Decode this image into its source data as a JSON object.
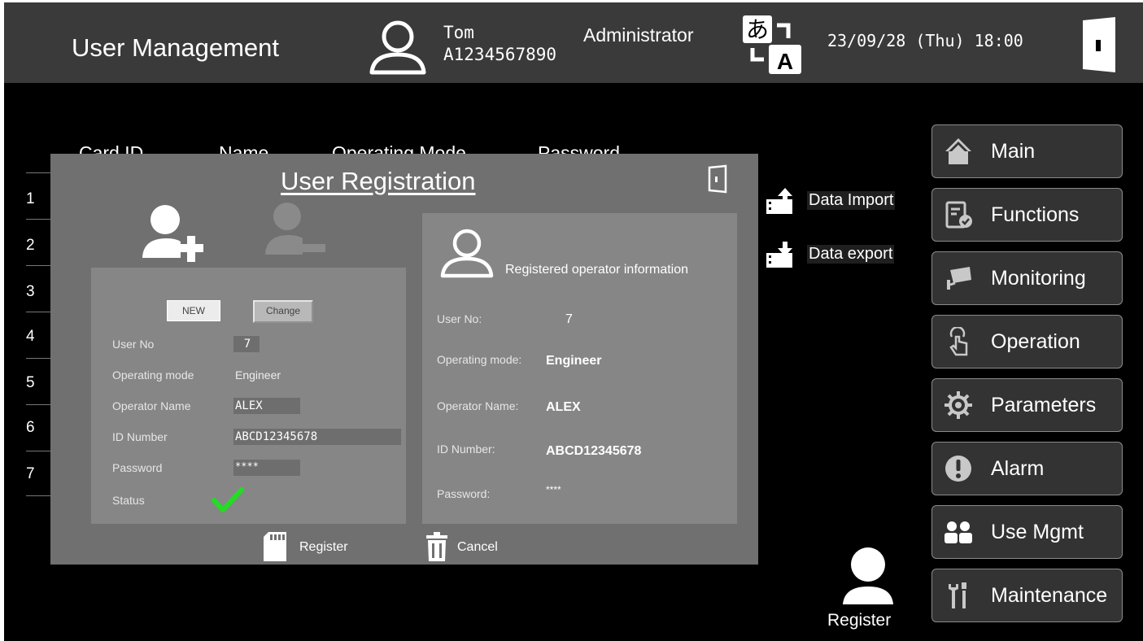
{
  "header": {
    "title": "User Management",
    "user_name": "Tom",
    "user_id": "A1234567890",
    "user_role": "Administrator",
    "datetime": "23/09/28 (Thu) 18:00",
    "lang_glyph_top": "あ",
    "lang_glyph_bottom": "A"
  },
  "table": {
    "columns": [
      "Card ID",
      "Name",
      "Operating Mode",
      "Password"
    ],
    "rows": [
      "1",
      "2",
      "3",
      "4",
      "5",
      "6",
      "7"
    ]
  },
  "data_actions": {
    "import_label": "Data Import",
    "export_label": "Data export"
  },
  "menu": [
    {
      "label": "Main",
      "icon": "home-icon"
    },
    {
      "label": "Functions",
      "icon": "checklist-icon"
    },
    {
      "label": "Monitoring",
      "icon": "cctv-icon"
    },
    {
      "label": "Operation",
      "icon": "touch-icon"
    },
    {
      "label": "Parameters",
      "icon": "gear-icon"
    },
    {
      "label": "Alarm",
      "icon": "alert-icon"
    },
    {
      "label": "Use Mgmt",
      "icon": "users-icon"
    },
    {
      "label": "Maintenance",
      "icon": "tools-icon"
    }
  ],
  "register_button": {
    "label": "Register"
  },
  "modal": {
    "title": "User Registration",
    "new_label": "NEW",
    "change_label": "Change",
    "form": {
      "user_no_label": "User No",
      "user_no": "7",
      "mode_label": "Operating mode",
      "mode": "Engineer",
      "name_label": "Operator Name",
      "name": "ALEX",
      "id_label": "ID Number",
      "id": "ABCD12345678",
      "password_label": "Password",
      "password": "****",
      "status_label": "Status"
    },
    "info": {
      "title": "Registered operator information",
      "user_no_label": "User No:",
      "user_no": "7",
      "mode_label": "Operating mode:",
      "mode": "Engineer",
      "name_label": "Operator Name:",
      "name": "ALEX",
      "id_label": "ID Number:",
      "id": "ABCD12345678",
      "password_label": "Password:",
      "password": "****"
    },
    "register_label": "Register",
    "cancel_label": "Cancel"
  },
  "colors": {
    "header_bg": "#3a3a3a",
    "modal_bg": "#707070",
    "panel_bg": "#868686",
    "menu_bg": "#333333",
    "check_green": "#22dd22"
  }
}
